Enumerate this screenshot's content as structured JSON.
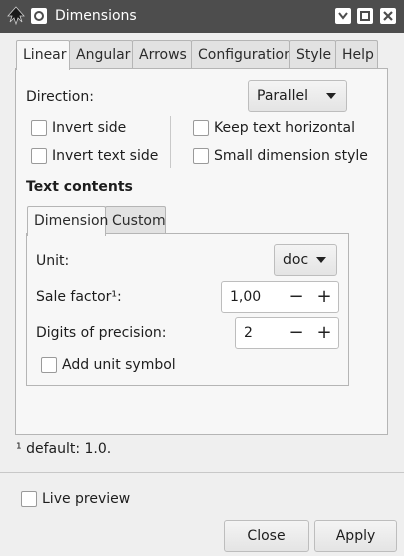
{
  "window": {
    "title": "Dimensions",
    "controls": [
      "minimize-icon",
      "maximize-icon",
      "close-icon"
    ]
  },
  "tabs": [
    {
      "label": "Linear",
      "active": true
    },
    {
      "label": "Angular",
      "active": false
    },
    {
      "label": "Arrows",
      "active": false
    },
    {
      "label": "Configuration",
      "active": false
    },
    {
      "label": "Style",
      "active": false
    },
    {
      "label": "Help",
      "active": false
    }
  ],
  "linear": {
    "direction_label": "Direction:",
    "direction_value": "Parallel",
    "checkboxes": {
      "invert_side": {
        "label": "Invert side",
        "checked": false
      },
      "invert_text_side": {
        "label": "Invert text side",
        "checked": false
      },
      "keep_text_horizontal": {
        "label": "Keep text horizontal",
        "checked": false
      },
      "small_dimension_style": {
        "label": "Small dimension style",
        "checked": false
      }
    },
    "text_contents_heading": "Text contents",
    "inner_tabs": [
      {
        "label": "Dimension",
        "active": true
      },
      {
        "label": "Custom",
        "active": false
      }
    ],
    "dimension": {
      "unit_label": "Unit:",
      "unit_value": "doc",
      "scale_factor_label": "Sale factor¹:",
      "scale_factor_value": "1,00",
      "digits_label": "Digits of precision:",
      "digits_value": "2",
      "add_unit_symbol": {
        "label": "Add unit symbol",
        "checked": false
      }
    }
  },
  "footnote": "¹ default: 1.0.",
  "live_preview": {
    "label": "Live preview",
    "checked": false
  },
  "buttons": {
    "close": "Close",
    "apply": "Apply"
  },
  "colors": {
    "titlebar": "#4d4d4d",
    "window_bg": "#efefef",
    "panel_bg": "#f7f7f7"
  }
}
